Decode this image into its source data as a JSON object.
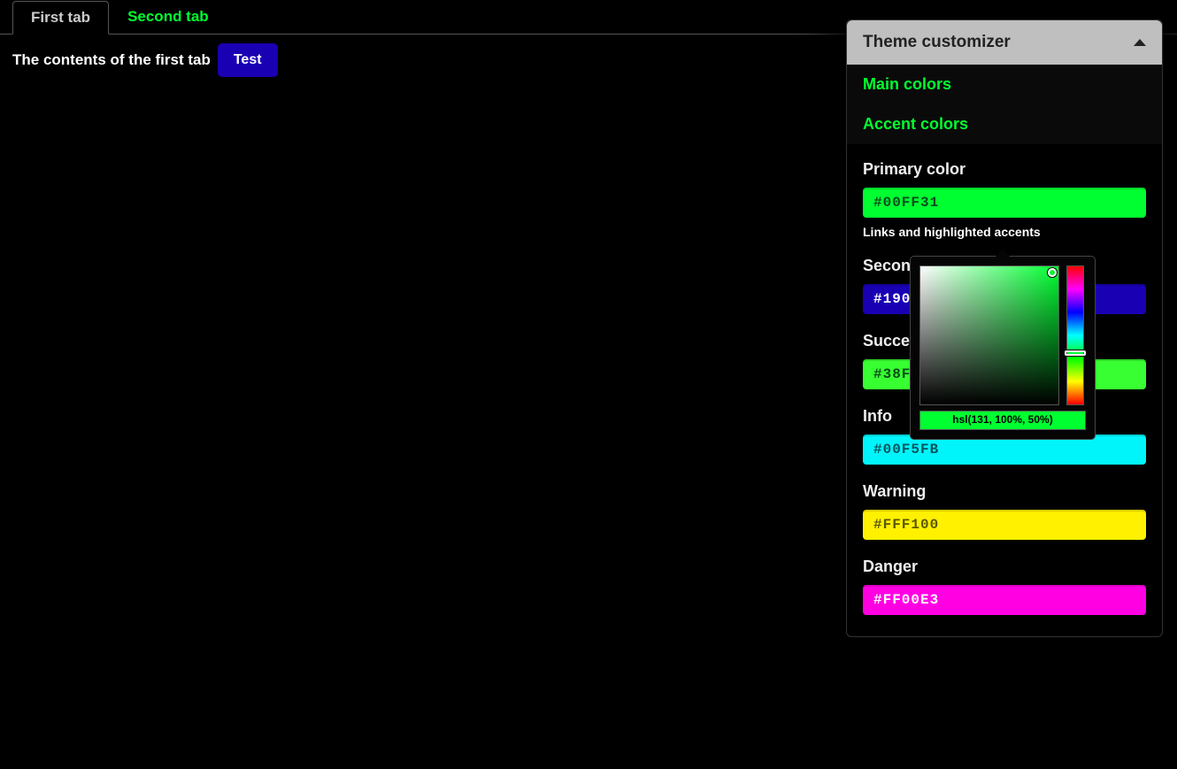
{
  "tabs": [
    {
      "label": "First tab",
      "active": true
    },
    {
      "label": "Second tab",
      "active": false
    }
  ],
  "tab_content": {
    "text": "The contents of the first tab",
    "button_label": "Test"
  },
  "customizer": {
    "title": "Theme customizer",
    "sections": [
      {
        "label": "Main colors"
      },
      {
        "label": "Accent colors"
      }
    ],
    "colors": {
      "primary": {
        "label": "Primary color",
        "value": "#00FF31",
        "desc": "Links and highlighted accents"
      },
      "secondary": {
        "label": "Secondary color",
        "value": "#1900B3"
      },
      "success": {
        "label": "Success",
        "value": "#38FF31"
      },
      "info": {
        "label": "Info",
        "value": "#00F5FB"
      },
      "warning": {
        "label": "Warning",
        "value": "#FFF100"
      },
      "danger": {
        "label": "Danger",
        "value": "#FF00E3"
      }
    }
  },
  "color_picker": {
    "hsl_text": "hsl(131, 100%, 50%)"
  }
}
